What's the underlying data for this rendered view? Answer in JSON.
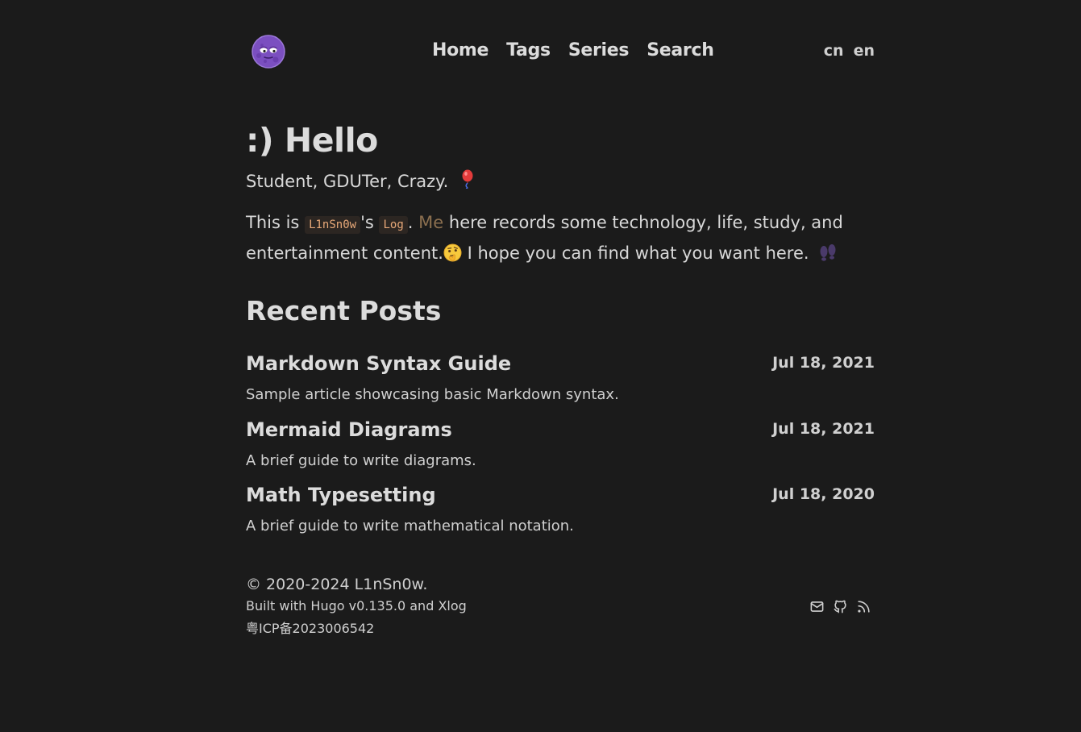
{
  "header": {
    "logo_icon": "purple-moon-face-emoji-icon",
    "nav": [
      "Home",
      "Tags",
      "Series",
      "Search"
    ],
    "languages": [
      "cn",
      "en"
    ]
  },
  "hero": {
    "title": ":) Hello",
    "tagline": "Student, GDUTer, Crazy.",
    "tagline_icon": "balloon-icon",
    "intro": {
      "prefix": "This is",
      "code_name": "L1nSn0w",
      "possessive": "'s",
      "code_log": "Log",
      "period": ".",
      "me_link": "Me",
      "text_1": "here records some technology, life, study, and entertainment content.",
      "face_icon": "thinking-face-emoji-icon",
      "text_2": "I hope you can find what you want here.",
      "footprints_icon": "footprints-icon"
    }
  },
  "recent_posts": {
    "heading": "Recent Posts",
    "items": [
      {
        "title": "Markdown Syntax Guide",
        "date": "Jul 18, 2021",
        "description": "Sample article showcasing basic Markdown syntax."
      },
      {
        "title": "Mermaid Diagrams",
        "date": "Jul 18, 2021",
        "description": "A brief guide to write diagrams."
      },
      {
        "title": "Math Typesetting",
        "date": "Jul 18, 2020",
        "description": "A brief guide to write mathematical notation."
      }
    ]
  },
  "footer": {
    "copyright": "© 2020-2024 L1nSn0w.",
    "built_prefix": "Built with",
    "hugo": "Hugo v0.135.0",
    "and": "and",
    "xlog": "Xlog",
    "icp": "粤ICP备2023006542",
    "social_icons": [
      "mail-icon",
      "github-icon",
      "rss-icon"
    ]
  },
  "colors": {
    "background": "#1b1b1b",
    "text": "#d8d8d8",
    "code_bg": "#2c2622",
    "code_text": "#e7a878",
    "me_link": "#8b6f4f"
  }
}
